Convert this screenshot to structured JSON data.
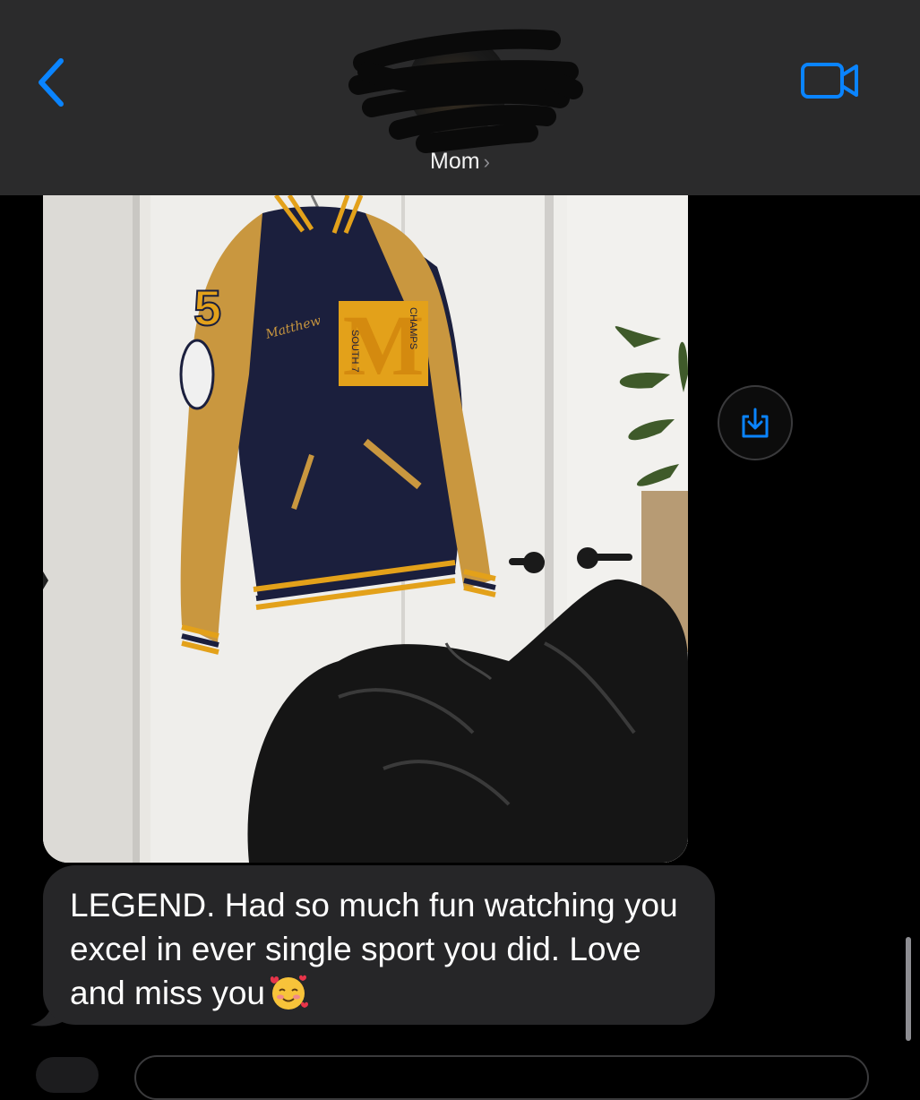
{
  "header": {
    "contact_name": "Mom",
    "chevron": "›",
    "back_icon": "chevron-left-icon",
    "video_icon": "video-camera-icon"
  },
  "photo": {
    "jacket_letter": "M",
    "jacket_number": "5",
    "jacket_name": "Matthew",
    "patch_left": "SOUTH 7",
    "patch_right": "CHAMPS"
  },
  "message": {
    "text": "LEGEND. Had so much fun watching you excel in ever single sport you did. Love and miss you",
    "emoji_icon": "smiling-face-with-hearts-icon"
  },
  "save_icon": "save-to-photos-icon",
  "colors": {
    "accent": "#0a84ff",
    "header_bg": "#2b2b2c",
    "bubble_bg": "#262628"
  }
}
